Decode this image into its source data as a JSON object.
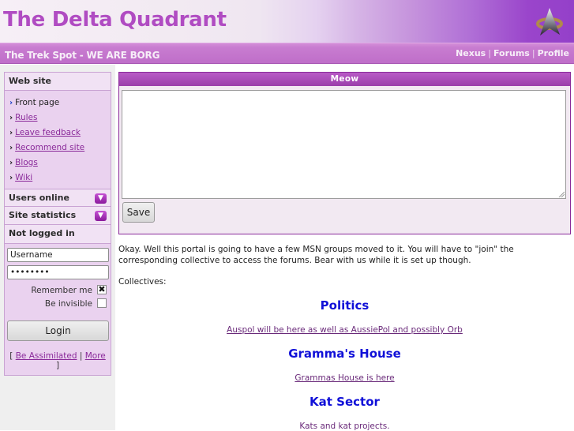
{
  "header": {
    "site_title": "The Delta Quadrant",
    "tagline": "The Trek Spot - WE ARE BORG",
    "logo_icon": "starfleet-combadge-icon",
    "nav_links": [
      {
        "label": "Nexus"
      },
      {
        "label": "Forums"
      },
      {
        "label": "Profile"
      }
    ],
    "nav_separator": "|"
  },
  "sidebar": {
    "web_site": {
      "title": "Web site",
      "bullet": "›",
      "items": [
        {
          "label": "Front page",
          "current": true
        },
        {
          "label": "Rules"
        },
        {
          "label": "Leave feedback"
        },
        {
          "label": "Recommend site"
        },
        {
          "label": "Blogs"
        },
        {
          "label": "Wiki"
        }
      ]
    },
    "users_online": {
      "title": "Users online",
      "toggle_icon": "chevron-down-icon"
    },
    "site_statistics": {
      "title": "Site statistics",
      "toggle_icon": "chevron-down-icon"
    },
    "login": {
      "title": "Not logged in",
      "username_value": "Username",
      "password_value": "••••••••",
      "remember_me_label": "Remember me",
      "remember_me_checked": true,
      "be_invisible_label": "Be invisible",
      "be_invisible_checked": false,
      "login_button": "Login",
      "bracket_open": "[",
      "bracket_close": "]",
      "link_separator": "|",
      "register_link": "Be Assimilated",
      "more_link": "More"
    }
  },
  "main": {
    "panel": {
      "title": "Meow",
      "textarea_value": "",
      "save_button": "Save"
    },
    "intro_text": "Okay. Well this portal is going to have a few MSN groups moved to it. You will have to \"join\" the corresponding collective to access the forums. Bear with us while it is set up though.",
    "collectives_label": "Collectives:",
    "collectives": [
      {
        "heading": "Politics",
        "description": "Auspol will be here as well as AussiePol and possibly Orb",
        "is_link": true
      },
      {
        "heading": "Gramma's House",
        "description": "Grammas House is here",
        "is_link": true
      },
      {
        "heading": "Kat Sector",
        "description": "Kats and kat projects.",
        "is_link": false
      }
    ]
  },
  "colors": {
    "brand_purple": "#b04cc2",
    "header_dark_purple": "#9440c9",
    "panel_header": "#9b3eaa",
    "heading_blue": "#1010d8",
    "link_purple": "#8a2a9a",
    "sidebar_bg": "#ead2ef"
  }
}
